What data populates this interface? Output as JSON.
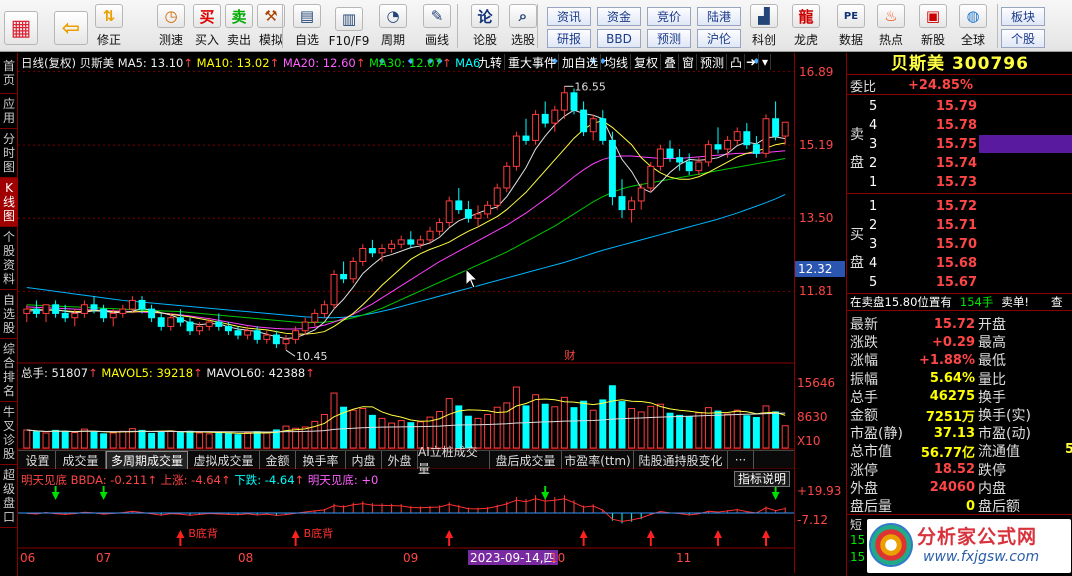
{
  "toolbar": {
    "buttons": [
      {
        "label": "",
        "icon": "grid-icon"
      },
      {
        "label": "",
        "icon": "back-arrow-icon"
      },
      {
        "label": "修正",
        "icon": "up-down-arrow-icon"
      },
      {
        "label": "测速",
        "icon": "clock-icon"
      },
      {
        "label": "买入",
        "icon": "buy-icon",
        "glyph": "买"
      },
      {
        "label": "卖出",
        "icon": "sell-icon",
        "glyph": "卖"
      },
      {
        "label": "模拟",
        "icon": "hammer-icon"
      },
      {
        "label": "自选",
        "icon": "watchlist-icon"
      },
      {
        "label": "F10/F9",
        "icon": "f10-icon"
      },
      {
        "label": "周期",
        "icon": "period-icon"
      },
      {
        "label": "画线",
        "icon": "pen-icon"
      },
      {
        "label": "论股",
        "icon": "discuss-icon",
        "glyph": "论"
      },
      {
        "label": "选股",
        "icon": "magnifier-icon"
      },
      {
        "label": "科创",
        "icon": "kechuang-icon"
      },
      {
        "label": "龙虎",
        "icon": "dragon-tiger-icon"
      },
      {
        "label": "数据",
        "icon": "pe-icon",
        "glyph": "PE"
      },
      {
        "label": "热点",
        "icon": "fire-icon"
      },
      {
        "label": "新股",
        "icon": "newstock-icon"
      },
      {
        "label": "全球",
        "icon": "globe-icon"
      }
    ],
    "pills": [
      "资讯",
      "资金",
      "竞价",
      "陆港",
      "研报",
      "BBD",
      "预测",
      "沪伦",
      "板块",
      "个股"
    ]
  },
  "sidebar": [
    "首页",
    "应用",
    "分时图",
    "K线图",
    "个股资料",
    "自选股",
    "综合排名",
    "牛叉诊股",
    "超级盘口"
  ],
  "chart": {
    "header": {
      "name": "日线(复权)",
      "stock": "贝斯美",
      "ma5": "MA5: 13.10",
      "ma10": "MA10: 13.02",
      "ma20": "MA20: 12.60",
      "ma30": "MA30: 12.07",
      "ma6": "MA6"
    },
    "topbuttons": [
      "九转",
      "重大事件",
      "加自选",
      "均线",
      "复权",
      "叠",
      "窗",
      "预测"
    ],
    "price_labels": [
      "16.89",
      "15.19",
      "13.50",
      "11.81"
    ],
    "current_price_tag": "12.32",
    "high_label": "16.55",
    "low_label": "10.45",
    "cai_label": "财",
    "volume": {
      "label": "总手: 51807",
      "mavol5": "MAVOL5: 39218",
      "mavol60": "MAVOL60: 42388",
      "axis": [
        "15646",
        "8630",
        "X10"
      ]
    },
    "tabs": [
      "设置",
      "成交量",
      "多周期成交量",
      "虚拟成交量",
      "金额",
      "换手率",
      "内盘",
      "外盘",
      "AI立桩成交量",
      "盘后成交量",
      "市盈率(ttm)",
      "陆股通持股变化",
      "···"
    ],
    "indicator": {
      "name": "明天见底",
      "bbda": "BBDA: -0.211",
      "up": "上涨: -4.64",
      "down": "下跌: -4.64",
      "mtjd": "明天见底: +0",
      "explain": "指标说明",
      "axis": [
        "+19.93",
        "-7.12"
      ],
      "bdb": "B底背"
    },
    "dates": [
      "06",
      "07",
      "08",
      "09",
      "2023-09-14,四",
      "10",
      "11"
    ]
  },
  "chart_data": {
    "type": "candlestick",
    "title": "贝斯美 300796 日线(复权)",
    "ylim": [
      10.2,
      16.95
    ],
    "candles": [
      [
        11.3,
        11.5,
        11.1,
        11.4
      ],
      [
        11.4,
        11.6,
        11.2,
        11.3
      ],
      [
        11.3,
        11.5,
        11.1,
        11.5
      ],
      [
        11.5,
        11.6,
        11.2,
        11.3
      ],
      [
        11.3,
        11.5,
        11.1,
        11.2
      ],
      [
        11.2,
        11.4,
        11.0,
        11.3
      ],
      [
        11.3,
        11.6,
        11.2,
        11.5
      ],
      [
        11.5,
        11.7,
        11.3,
        11.4
      ],
      [
        11.4,
        11.5,
        11.1,
        11.2
      ],
      [
        11.2,
        11.4,
        11.0,
        11.3
      ],
      [
        11.3,
        11.5,
        11.2,
        11.4
      ],
      [
        11.4,
        11.7,
        11.3,
        11.6
      ],
      [
        11.6,
        11.7,
        11.3,
        11.4
      ],
      [
        11.4,
        11.5,
        11.1,
        11.2
      ],
      [
        11.2,
        11.3,
        10.9,
        11.0
      ],
      [
        11.0,
        11.3,
        10.9,
        11.2
      ],
      [
        11.2,
        11.4,
        11.0,
        11.1
      ],
      [
        11.1,
        11.2,
        10.8,
        10.9
      ],
      [
        10.9,
        11.1,
        10.8,
        11.0
      ],
      [
        11.0,
        11.2,
        10.9,
        11.1
      ],
      [
        11.1,
        11.3,
        10.9,
        11.0
      ],
      [
        11.0,
        11.1,
        10.8,
        10.9
      ],
      [
        10.9,
        11.0,
        10.7,
        10.8
      ],
      [
        10.8,
        11.0,
        10.7,
        10.9
      ],
      [
        10.9,
        11.0,
        10.6,
        10.7
      ],
      [
        10.7,
        10.9,
        10.6,
        10.8
      ],
      [
        10.8,
        10.9,
        10.5,
        10.6
      ],
      [
        10.6,
        10.8,
        10.45,
        10.7
      ],
      [
        10.7,
        11.0,
        10.6,
        10.9
      ],
      [
        10.9,
        11.2,
        10.8,
        11.1
      ],
      [
        11.1,
        11.4,
        11.0,
        11.3
      ],
      [
        11.3,
        11.6,
        11.2,
        11.5
      ],
      [
        11.5,
        12.3,
        11.4,
        12.2
      ],
      [
        12.2,
        12.5,
        12.0,
        12.1
      ],
      [
        12.1,
        12.6,
        12.0,
        12.5
      ],
      [
        12.5,
        12.9,
        12.4,
        12.8
      ],
      [
        12.8,
        13.0,
        12.6,
        12.7
      ],
      [
        12.7,
        12.9,
        12.5,
        12.8
      ],
      [
        12.8,
        13.0,
        12.7,
        12.9
      ],
      [
        12.9,
        13.1,
        12.8,
        13.0
      ],
      [
        13.0,
        13.2,
        12.8,
        12.9
      ],
      [
        12.9,
        13.1,
        12.8,
        13.0
      ],
      [
        13.0,
        13.3,
        12.9,
        13.2
      ],
      [
        13.2,
        13.5,
        13.1,
        13.4
      ],
      [
        13.4,
        14.0,
        13.3,
        13.9
      ],
      [
        13.9,
        14.2,
        13.6,
        13.7
      ],
      [
        13.7,
        13.9,
        13.4,
        13.5
      ],
      [
        13.5,
        13.8,
        13.3,
        13.6
      ],
      [
        13.6,
        13.9,
        13.5,
        13.8
      ],
      [
        13.8,
        14.3,
        13.7,
        14.2
      ],
      [
        14.2,
        14.8,
        14.1,
        14.7
      ],
      [
        14.7,
        15.5,
        14.6,
        15.4
      ],
      [
        15.4,
        15.8,
        15.2,
        15.3
      ],
      [
        15.3,
        16.0,
        15.2,
        15.9
      ],
      [
        15.9,
        16.2,
        15.6,
        15.7
      ],
      [
        15.7,
        16.1,
        15.5,
        16.0
      ],
      [
        16.0,
        16.55,
        15.8,
        16.4
      ],
      [
        16.4,
        16.5,
        15.9,
        16.0
      ],
      [
        16.0,
        16.2,
        15.4,
        15.5
      ],
      [
        15.5,
        15.9,
        15.3,
        15.8
      ],
      [
        15.8,
        16.0,
        15.2,
        15.3
      ],
      [
        15.3,
        15.5,
        13.8,
        14.0
      ],
      [
        14.0,
        14.4,
        13.5,
        13.7
      ],
      [
        13.7,
        14.0,
        13.4,
        13.9
      ],
      [
        13.9,
        14.3,
        13.7,
        14.2
      ],
      [
        14.2,
        14.8,
        14.1,
        14.7
      ],
      [
        14.7,
        15.2,
        14.6,
        15.1
      ],
      [
        15.1,
        15.3,
        14.8,
        14.9
      ],
      [
        14.9,
        15.1,
        14.6,
        14.8
      ],
      [
        14.8,
        15.0,
        14.5,
        14.6
      ],
      [
        14.6,
        14.9,
        14.5,
        14.8
      ],
      [
        14.8,
        15.3,
        14.7,
        15.2
      ],
      [
        15.2,
        15.6,
        15.0,
        15.1
      ],
      [
        15.1,
        15.4,
        14.9,
        15.3
      ],
      [
        15.3,
        15.6,
        15.2,
        15.5
      ],
      [
        15.5,
        15.7,
        15.1,
        15.2
      ],
      [
        15.2,
        15.4,
        14.9,
        15.0
      ],
      [
        15.0,
        15.9,
        14.9,
        15.8
      ],
      [
        15.8,
        16.2,
        15.3,
        15.4
      ],
      [
        15.4,
        15.7,
        15.2,
        15.72
      ]
    ],
    "ma5": [
      11.35,
      11.37,
      11.38,
      11.39,
      11.35,
      11.32,
      11.33,
      11.36,
      11.35,
      11.32,
      11.32,
      11.35,
      11.41,
      11.38,
      11.32,
      11.26,
      11.18,
      11.08,
      11.04,
      11.06,
      11.06,
      10.99,
      10.94,
      10.91,
      10.88,
      10.82,
      10.76,
      10.72,
      10.74,
      10.82,
      10.92,
      11.1,
      11.4,
      11.63,
      11.91,
      12.22,
      12.42,
      12.6,
      12.66,
      12.74,
      12.82,
      12.86,
      12.93,
      13.06,
      13.28,
      13.44,
      13.53,
      13.62,
      13.7,
      13.76,
      14.0,
      14.33,
      14.67,
      15.1,
      15.4,
      15.66,
      15.86,
      16.0,
      15.92,
      15.88,
      15.8,
      15.32,
      14.86,
      14.58,
      14.2,
      14.1,
      14.32,
      14.56,
      14.74,
      14.86,
      14.84,
      14.86,
      14.9,
      15.0,
      15.18,
      15.26,
      15.22,
      15.36,
      15.38,
      15.34
    ],
    "ma10": [
      11.4,
      11.39,
      11.38,
      11.37,
      11.36,
      11.34,
      11.35,
      11.37,
      11.36,
      11.34,
      11.33,
      11.33,
      11.35,
      11.34,
      11.31,
      11.28,
      11.25,
      11.22,
      11.18,
      11.14,
      11.1,
      11.05,
      11.0,
      10.96,
      10.94,
      10.92,
      10.88,
      10.84,
      10.82,
      10.82,
      10.84,
      10.88,
      11.0,
      11.15,
      11.3,
      11.5,
      11.72,
      11.95,
      12.15,
      12.35,
      12.55,
      12.68,
      12.78,
      12.86,
      12.95,
      13.08,
      13.2,
      13.3,
      13.42,
      13.54,
      13.7,
      13.9,
      14.1,
      14.35,
      14.6,
      14.85,
      15.1,
      15.35,
      15.55,
      15.7,
      15.75,
      15.6,
      15.4,
      15.2,
      14.9,
      14.7,
      14.55,
      14.45,
      14.4,
      14.4,
      14.46,
      14.56,
      14.68,
      14.8,
      14.92,
      15.0,
      15.05,
      15.12,
      15.2,
      15.24
    ],
    "ma20": [
      11.45,
      11.44,
      11.43,
      11.42,
      11.41,
      11.4,
      11.39,
      11.38,
      11.37,
      11.36,
      11.35,
      11.34,
      11.33,
      11.32,
      11.31,
      11.29,
      11.27,
      11.24,
      11.21,
      11.18,
      11.14,
      11.1,
      11.06,
      11.02,
      10.99,
      10.97,
      10.95,
      10.94,
      10.94,
      10.95,
      10.98,
      11.03,
      11.1,
      11.18,
      11.28,
      11.4,
      11.52,
      11.66,
      11.8,
      11.94,
      12.08,
      12.22,
      12.36,
      12.5,
      12.62,
      12.74,
      12.86,
      12.98,
      13.1,
      13.22,
      13.34,
      13.48,
      13.62,
      13.78,
      13.94,
      14.1,
      14.28,
      14.46,
      14.62,
      14.76,
      14.86,
      14.92,
      14.94,
      14.94,
      14.92,
      14.9,
      14.88,
      14.88,
      14.88,
      14.9,
      14.92,
      14.94,
      14.96,
      14.98,
      15.0,
      15.0,
      15.0,
      15.02,
      15.04,
      15.06
    ],
    "ma30": [
      11.5,
      11.49,
      11.48,
      11.47,
      11.46,
      11.45,
      11.44,
      11.43,
      11.42,
      11.41,
      11.4,
      11.39,
      11.38,
      11.37,
      11.36,
      11.35,
      11.34,
      11.32,
      11.3,
      11.28,
      11.26,
      11.24,
      11.22,
      11.2,
      11.18,
      11.16,
      11.14,
      11.12,
      11.1,
      11.09,
      11.09,
      11.1,
      11.12,
      11.15,
      11.2,
      11.26,
      11.34,
      11.42,
      11.52,
      11.62,
      11.72,
      11.82,
      11.92,
      12.02,
      12.12,
      12.22,
      12.32,
      12.42,
      12.52,
      12.62,
      12.72,
      12.84,
      12.96,
      13.08,
      13.2,
      13.32,
      13.46,
      13.6,
      13.74,
      13.88,
      14.0,
      14.1,
      14.18,
      14.24,
      14.28,
      14.32,
      14.36,
      14.4,
      14.44,
      14.48,
      14.52,
      14.56,
      14.6,
      14.64,
      14.68,
      14.72,
      14.76,
      14.8,
      14.84,
      14.88
    ],
    "ma60": [
      11.9,
      11.87,
      11.84,
      11.81,
      11.78,
      11.75,
      11.72,
      11.69,
      11.66,
      11.63,
      11.6,
      11.58,
      11.56,
      11.54,
      11.52,
      11.5,
      11.48,
      11.46,
      11.44,
      11.42,
      11.4,
      11.38,
      11.36,
      11.34,
      11.32,
      11.3,
      11.28,
      11.26,
      11.24,
      11.22,
      11.21,
      11.2,
      11.2,
      11.21,
      11.23,
      11.26,
      11.3,
      11.35,
      11.4,
      11.46,
      11.52,
      11.58,
      11.64,
      11.7,
      11.76,
      11.82,
      11.88,
      11.94,
      12.0,
      12.06,
      12.12,
      12.18,
      12.24,
      12.3,
      12.36,
      12.42,
      12.48,
      12.55,
      12.62,
      12.69,
      12.76,
      12.82,
      12.88,
      12.94,
      13.0,
      13.06,
      13.12,
      13.18,
      13.24,
      13.3,
      13.36,
      13.42,
      13.48,
      13.55,
      13.62,
      13.7,
      13.78,
      13.86,
      13.95,
      14.05
    ],
    "volume": [
      4200,
      3800,
      3500,
      4100,
      3900,
      3600,
      4400,
      3700,
      3300,
      3500,
      3900,
      4500,
      4100,
      3400,
      3800,
      4000,
      3600,
      3900,
      3500,
      3300,
      3700,
      3400,
      3100,
      3600,
      3800,
      3500,
      4200,
      5100,
      4600,
      4900,
      6200,
      7800,
      12800,
      9500,
      8800,
      9200,
      7600,
      6900,
      5800,
      6400,
      5900,
      6100,
      7200,
      8500,
      11500,
      9800,
      7400,
      6900,
      7800,
      9500,
      10500,
      14200,
      9800,
      12400,
      10200,
      9600,
      11800,
      9400,
      10900,
      8800,
      11200,
      14500,
      10800,
      9200,
      8400,
      9700,
      10200,
      8100,
      7600,
      7300,
      8200,
      9400,
      8600,
      7900,
      8800,
      7500,
      7100,
      9800,
      8400,
      5180
    ],
    "vol_ylim": [
      0,
      17000
    ]
  },
  "quote": {
    "name": "贝斯美",
    "code": "300796",
    "weibi_label": "委比",
    "weibi": "+24.85%",
    "sell_label": "卖盘",
    "buy_label": "买盘",
    "asks": [
      {
        "n": "5",
        "p": "15.79"
      },
      {
        "n": "4",
        "p": "15.78"
      },
      {
        "n": "3",
        "p": "15.75"
      },
      {
        "n": "2",
        "p": "15.74"
      },
      {
        "n": "1",
        "p": "15.73"
      }
    ],
    "bids": [
      {
        "n": "1",
        "p": "15.72"
      },
      {
        "n": "2",
        "p": "15.71"
      },
      {
        "n": "3",
        "p": "15.70"
      },
      {
        "n": "4",
        "p": "15.68"
      },
      {
        "n": "5",
        "p": "15.67"
      }
    ],
    "notice": "在卖盘15.80位置有",
    "notice_vol": "154手",
    "notice_act": "卖单!",
    "notice_tail": "查",
    "stats_left": [
      {
        "k": "最新",
        "v": "15.72",
        "c": "red"
      },
      {
        "k": "涨跌",
        "v": "+0.29",
        "c": "red"
      },
      {
        "k": "涨幅",
        "v": "+1.88%",
        "c": "red"
      },
      {
        "k": "振幅",
        "v": "5.64%",
        "c": "yellow"
      },
      {
        "k": "总手",
        "v": "46275",
        "c": "yellow"
      },
      {
        "k": "金额",
        "v": "7251万",
        "c": "yellow"
      },
      {
        "k": "市盈(静)",
        "v": "37.13",
        "c": "yellow"
      },
      {
        "k": "总市值",
        "v": "56.77亿",
        "c": "yellow"
      },
      {
        "k": "涨停",
        "v": "18.52",
        "c": "red"
      },
      {
        "k": "外盘",
        "v": "24060",
        "c": "red"
      },
      {
        "k": "盘后量",
        "v": "0",
        "c": "yellow"
      }
    ],
    "stats_right": [
      "开盘",
      "最高",
      "最低",
      "量比",
      "换手",
      "换手(实)",
      "市盈(动)",
      "流通值",
      "跌停",
      "内盘",
      "盘后额"
    ],
    "right_tail": "5",
    "bottom_labels": [
      "短",
      "15",
      "15"
    ],
    "watermark": "分析家公式网",
    "watermark_url": "www.fxjgsw.com"
  }
}
